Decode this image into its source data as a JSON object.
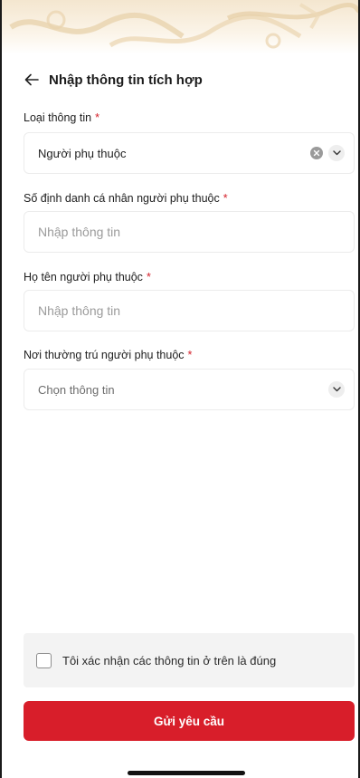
{
  "header": {
    "title": "Nhập thông tin tích hợp"
  },
  "form": {
    "info_type": {
      "label": "Loại thông tin",
      "value": "Người phụ thuộc"
    },
    "id_number": {
      "label": "Số định danh cá nhân người phụ thuộc",
      "placeholder": "Nhập thông tin"
    },
    "full_name": {
      "label": "Họ tên người phụ thuộc",
      "placeholder": "Nhập thông tin"
    },
    "residence": {
      "label": "Nơi thường trú người phụ thuộc",
      "placeholder": "Chọn thông tin"
    },
    "required_mark": "*"
  },
  "confirm": {
    "label": "Tôi xác nhận các thông tin ở trên là đúng",
    "checked": false
  },
  "submit": {
    "label": "Gửi yêu cầu"
  },
  "colors": {
    "accent": "#d81e2a",
    "required": "#d4202a",
    "hero": "#f4e6cf"
  },
  "icons": {
    "back": "arrow-left-icon",
    "clear": "clear-x-icon",
    "dropdown": "chevron-down-icon"
  }
}
